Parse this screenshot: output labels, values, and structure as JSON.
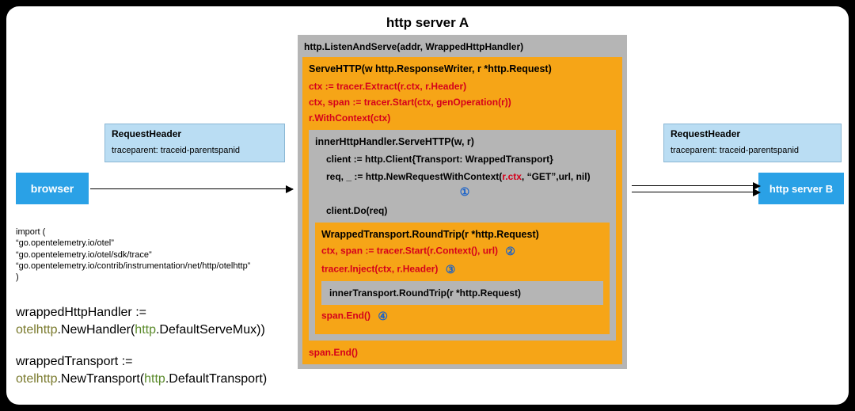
{
  "title": "http server A",
  "browser": {
    "label": "browser"
  },
  "server_b": {
    "label": "http server B"
  },
  "req_header_left": {
    "label": "RequestHeader",
    "value": "traceparent: traceid-parentspanid"
  },
  "req_header_right": {
    "label": "RequestHeader",
    "value": "traceparent: traceid-parentspanid"
  },
  "server_block": {
    "listen": "http.ListenAndServe(addr, WrappedHttpHandler)",
    "serve": {
      "signature": "ServeHTTP(w http.ResponseWriter, r *http.Request)",
      "l1": "ctx := tracer.Extract(r.ctx, r.Header)",
      "l2": "ctx, span := tracer.Start(ctx, genOperation(r))",
      "l3": "r.WithContext(ctx)",
      "inner": {
        "signature": "innerHttpHandler.ServeHTTP(w, r)",
        "c1": "client := http.Client{Transport: WrappedTransport}",
        "c2_pre": "req, _ := http.NewRequestWithContext(",
        "c2_red": "r.ctx",
        "c2_post": ", “GET”,url, nil)",
        "c3": "client.Do(req)",
        "wrapped": {
          "signature": "WrappedTransport.RoundTrip(r *http.Request)",
          "w1": "ctx, span := tracer.Start(r.Context(), url)",
          "w2": "tracer.Inject(ctx, r.Header)",
          "inner_round": "innerTransport.RoundTrip(r *http.Request)",
          "w3": "span.End()"
        }
      },
      "span_end": "span.End()"
    }
  },
  "circles": {
    "c1": "①",
    "c2": "②",
    "c3": "③",
    "c4": "④"
  },
  "import_block": {
    "open": "import (",
    "l1": "  “go.opentelemetry.io/otel”",
    "l2": "  “go.opentelemetry.io/otel/sdk/trace”",
    "l3": "  “go.opentelemetry.io/contrib/instrumentation/net/http/otelhttp”",
    "close": ")"
  },
  "assign1": {
    "lhs": "wrappedHttpHandler :=",
    "p1": "otelhttp",
    "p2": ".NewHandler(",
    "p3": "http",
    "p4": ".DefaultServeMux))"
  },
  "assign2": {
    "lhs": "wrappedTransport :=",
    "p1": "otelhttp",
    "p2": ".NewTransport(",
    "p3": "http",
    "p4": ".DefaultTransport)"
  }
}
